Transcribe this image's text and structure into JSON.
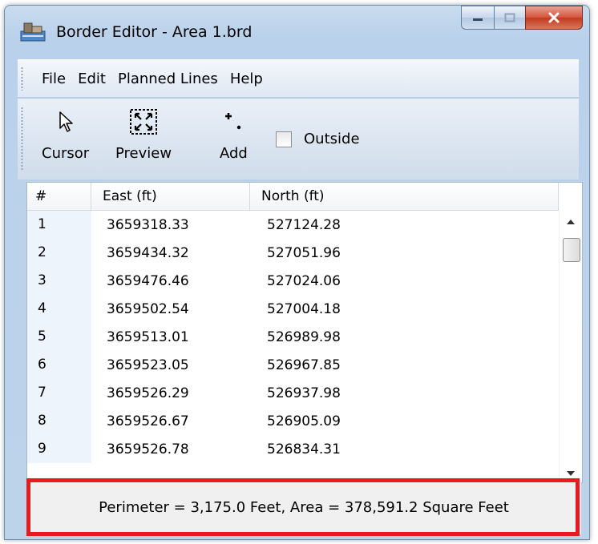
{
  "window": {
    "title": "Border Editor - Area 1.brd"
  },
  "menubar": {
    "items": [
      "File",
      "Edit",
      "Planned Lines",
      "Help"
    ]
  },
  "toolbar": {
    "cursor_label": "Cursor",
    "preview_label": "Preview",
    "add_label": "Add",
    "outside_label": "Outside",
    "outside_checked": false
  },
  "grid": {
    "columns": [
      "#",
      "East (ft)",
      "North (ft)"
    ],
    "rows": [
      [
        "1",
        "3659318.33",
        "527124.28"
      ],
      [
        "2",
        "3659434.32",
        "527051.96"
      ],
      [
        "3",
        "3659476.46",
        "527024.06"
      ],
      [
        "4",
        "3659502.54",
        "527004.18"
      ],
      [
        "5",
        "3659513.01",
        "526989.98"
      ],
      [
        "6",
        "3659523.05",
        "526967.85"
      ],
      [
        "7",
        "3659526.29",
        "526937.98"
      ],
      [
        "8",
        "3659526.67",
        "526905.09"
      ],
      [
        "9",
        "3659526.78",
        "526834.31"
      ]
    ]
  },
  "status": {
    "text": "Perimeter = 3,175.0 Feet,  Area = 378,591.2 Square Feet"
  },
  "colors": {
    "highlight": "#e31b23",
    "close_button": "#c23a1f"
  }
}
